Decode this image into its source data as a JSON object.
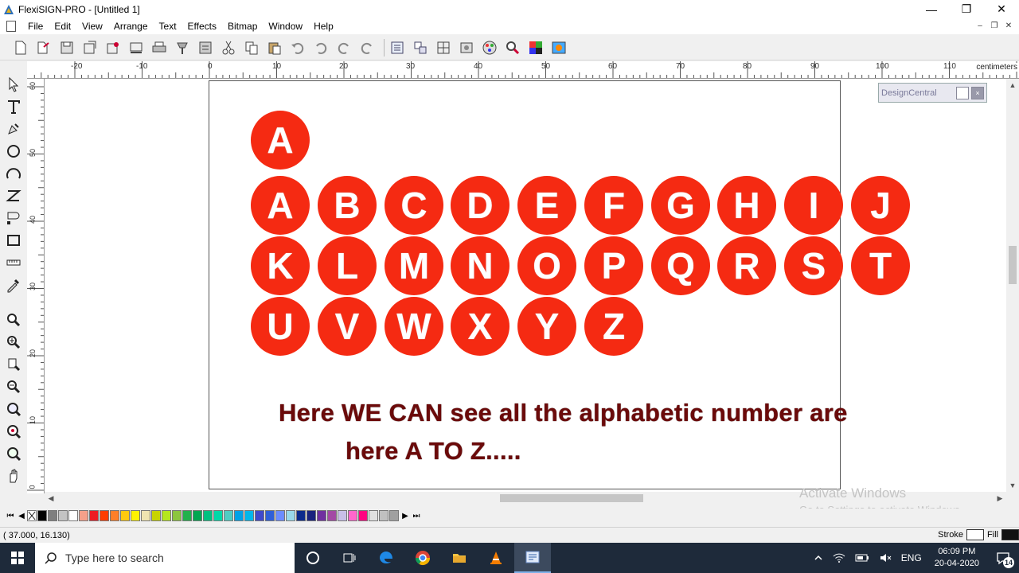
{
  "window": {
    "title": "FlexiSIGN-PRO - [Untitled 1]",
    "minimize": "—",
    "restore": "❐",
    "close": "✕"
  },
  "menu": {
    "items": [
      "File",
      "Edit",
      "View",
      "Arrange",
      "Text",
      "Effects",
      "Bitmap",
      "Window",
      "Help"
    ],
    "mdi_minimize": "–",
    "mdi_restore": "❐",
    "mdi_close": "✕"
  },
  "ruler": {
    "units": "centimeters",
    "top_labels": [
      "-20",
      "-10",
      "0",
      "10",
      "20",
      "30",
      "40",
      "50",
      "60",
      "70",
      "80",
      "90",
      "100",
      "110"
    ],
    "left_labels": [
      "60",
      "50",
      "40",
      "30",
      "20",
      "10",
      "0"
    ]
  },
  "design_central": {
    "title": "DesignCentral",
    "close": "×"
  },
  "canvas": {
    "single_letter": "A",
    "rows": [
      [
        "A",
        "B",
        "C",
        "D",
        "E",
        "F",
        "G",
        "H",
        "I",
        "J"
      ],
      [
        "K",
        "L",
        "M",
        "N",
        "O",
        "P",
        "Q",
        "R",
        "S",
        "T"
      ],
      [
        "U",
        "V",
        "W",
        "X",
        "Y",
        "Z"
      ]
    ],
    "caption_line1": "Here WE CAN see all the alphabetic number are",
    "caption_line2": "here A TO Z.....",
    "circle_color": "#f52a12",
    "caption_color": "#6b0a0a"
  },
  "palette": {
    "colors": [
      "#000000",
      "#7f7f7f",
      "#c3c3c3",
      "#ffffff",
      "#f4a08a",
      "#ed1c24",
      "#ff3c00",
      "#ff7f27",
      "#ffc90e",
      "#fff200",
      "#efe4b0",
      "#c8d400",
      "#b5e61d",
      "#8cc63e",
      "#22b14c",
      "#00a651",
      "#00c080",
      "#00d8a8",
      "#4ecdc4",
      "#00a2e8",
      "#00b7eb",
      "#3f48cc",
      "#2f5fd8",
      "#6c8cff",
      "#99d9ea",
      "#0b2a8c",
      "#1a237e",
      "#7030a0",
      "#a349a4",
      "#c8bfe7",
      "#ff66cc",
      "#ff0080",
      "#e0e0e0",
      "#c0c0c0",
      "#a0a0a0"
    ]
  },
  "watermark": {
    "title": "Activate Windows",
    "subtitle": "Go to Settings to activate Windows."
  },
  "status": {
    "coords": "( 37.000,    16.130)",
    "stroke_label": "Stroke",
    "fill_label": "Fill"
  },
  "taskbar": {
    "search_placeholder": "Type here to search",
    "language": "ENG",
    "time": "06:09 PM",
    "date": "20-04-2020",
    "notification_count": "14"
  }
}
